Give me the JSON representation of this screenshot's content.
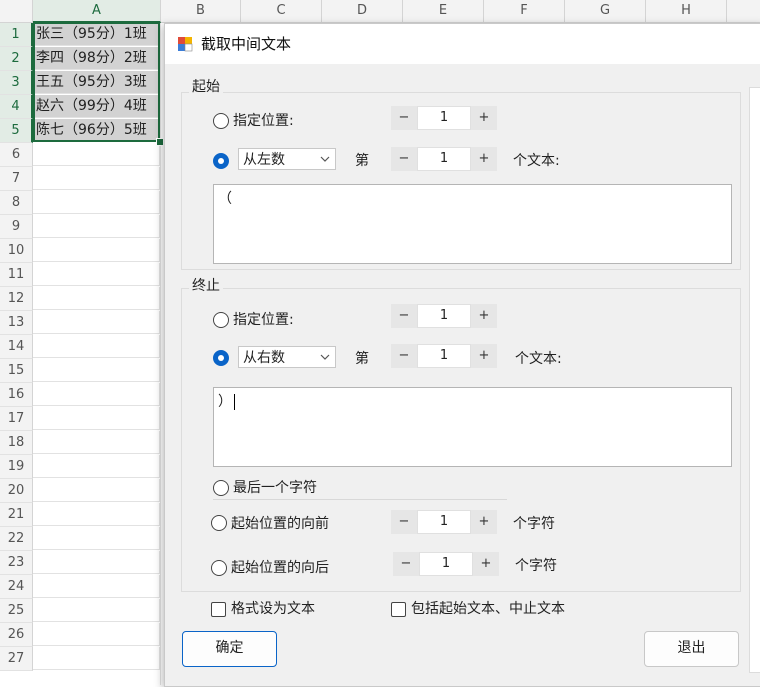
{
  "sheet": {
    "columns": [
      "A",
      "B",
      "C",
      "D",
      "E",
      "F",
      "G",
      "H"
    ],
    "rows": [
      "1",
      "2",
      "3",
      "4",
      "5",
      "6",
      "7",
      "8",
      "9",
      "10",
      "11",
      "12",
      "13",
      "14",
      "15",
      "16",
      "17",
      "18",
      "19",
      "20",
      "21",
      "22",
      "23",
      "24",
      "25",
      "26",
      "27"
    ],
    "cells": [
      "张三（95分）1班",
      "李四（98分）2班",
      "王五（95分）3班",
      "赵六（99分）4班",
      "陈七（96分）5班"
    ]
  },
  "dialog": {
    "title": "截取中间文本",
    "start": {
      "group_label": "起始",
      "option_position": "指定位置:",
      "position_value": "1",
      "mode_value": "从左数",
      "nth_label": "第",
      "nth_value": "1",
      "unit_label": "个文本:",
      "text_value": "（"
    },
    "end": {
      "group_label": "终止",
      "option_position": "指定位置:",
      "position_value": "1",
      "mode_value": "从右数",
      "nth_label": "第",
      "nth_value": "1",
      "unit_label": "个文本:",
      "text_value": "）",
      "option_last_char": "最后一个字符",
      "option_before": "起始位置的向前",
      "before_value": "1",
      "before_unit": "个字符",
      "option_after": "起始位置的向后",
      "after_value": "1",
      "after_unit": "个字符"
    },
    "format_as_text": "格式设为文本",
    "include_text": "包括起始文本、中止文本",
    "ok_label": "确定",
    "exit_label": "退出"
  },
  "colors": {
    "accent": "#0a64c8",
    "excel_green": "#1d6b3e"
  }
}
